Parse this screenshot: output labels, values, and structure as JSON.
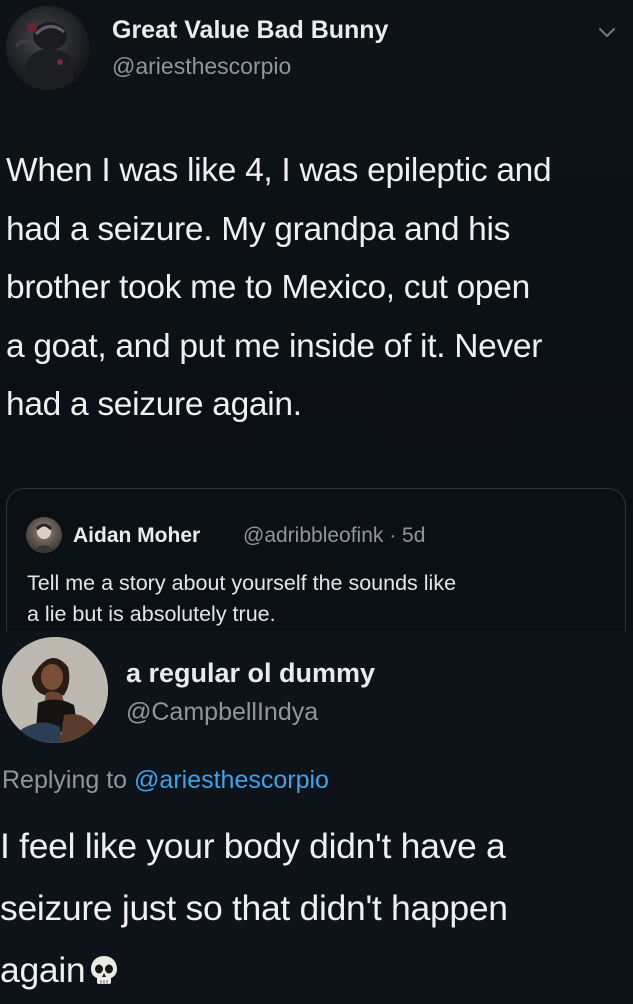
{
  "tweet": {
    "author_name": "Great Value Bad Bunny",
    "author_handle": "@ariesthescorpio",
    "menu_icon": "chevron-down-icon",
    "text_lines": [
      "When I was like 4, I was epileptic and",
      "had a seizure. My grandpa and his",
      "brother took me to Mexico, cut open",
      "a goat, and put me inside of it. Never",
      "had a seizure again."
    ],
    "quoted_tweet": {
      "author_name": "Aidan Moher",
      "author_handle_time": "@adribbleofink · 5d",
      "text_lines": [
        "Tell me a story about yourself the sounds like",
        "a lie but is absolutely true."
      ]
    }
  },
  "reply": {
    "author_name": "a regular ol dummy",
    "author_handle": "@CampbellIndya",
    "replying_prefix": "Replying to",
    "replying_to": "@ariesthescorpio",
    "text_lines": [
      "I feel like your body didn't have a",
      "seizure just so that didn't happen",
      "again"
    ],
    "emoji_icon": "skull-emoji-icon"
  },
  "colors": {
    "background": "#0c1116",
    "primary_text": "#eef0f1",
    "secondary_text": "#8c979f",
    "link": "#3fa2ec",
    "border": "#2c343b"
  }
}
